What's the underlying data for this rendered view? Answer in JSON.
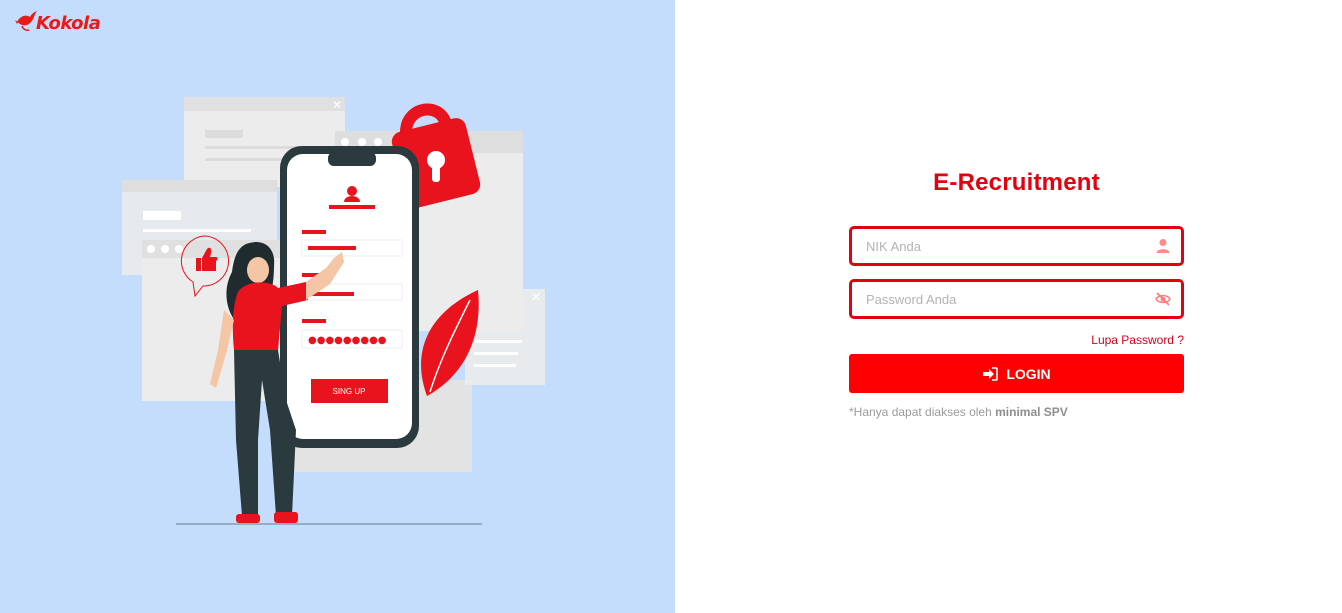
{
  "brand": {
    "name": "Kokola"
  },
  "illustration": {
    "phone_button_label": "SING UP"
  },
  "login": {
    "title": "E-Recruitment",
    "nik_placeholder": "NIK Anda",
    "password_placeholder": "Password Anda",
    "forgot_label": "Lupa Password ?",
    "login_label": "LOGIN",
    "note_prefix": "*Hanya dapat diakses oleh ",
    "note_bold": "minimal SPV"
  },
  "colors": {
    "accent": "#e3000f",
    "button": "#fe0000",
    "left_bg": "#c4ddfc"
  },
  "icons": {
    "nik": "user-icon",
    "password": "eye-slash-icon",
    "login": "sign-in-icon",
    "brand": "bird-logo-icon"
  }
}
